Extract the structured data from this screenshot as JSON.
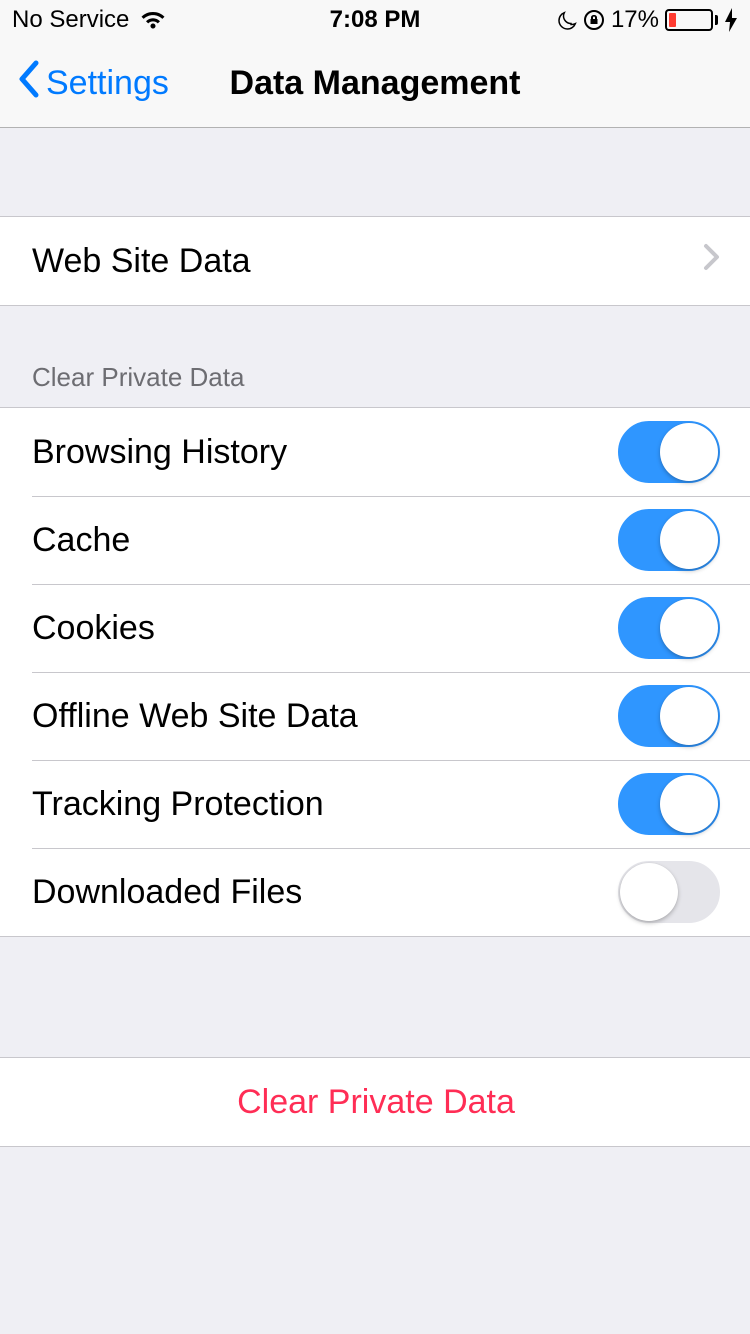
{
  "status_bar": {
    "carrier": "No Service",
    "time": "7:08 PM",
    "battery_percent": "17%"
  },
  "nav": {
    "back_label": "Settings",
    "title": "Data Management"
  },
  "sections": {
    "web_site_data": {
      "label": "Web Site Data"
    },
    "clear_private_data_header": "Clear Private Data",
    "toggles": [
      {
        "label": "Browsing History",
        "on": true
      },
      {
        "label": "Cache",
        "on": true
      },
      {
        "label": "Cookies",
        "on": true
      },
      {
        "label": "Offline Web Site Data",
        "on": true
      },
      {
        "label": "Tracking Protection",
        "on": true
      },
      {
        "label": "Downloaded Files",
        "on": false
      }
    ],
    "clear_button_label": "Clear Private Data"
  },
  "colors": {
    "accent_blue": "#007aff",
    "switch_on": "#2f96ff",
    "destructive_pink": "#ff2d55",
    "battery_low": "#ff3b30"
  }
}
